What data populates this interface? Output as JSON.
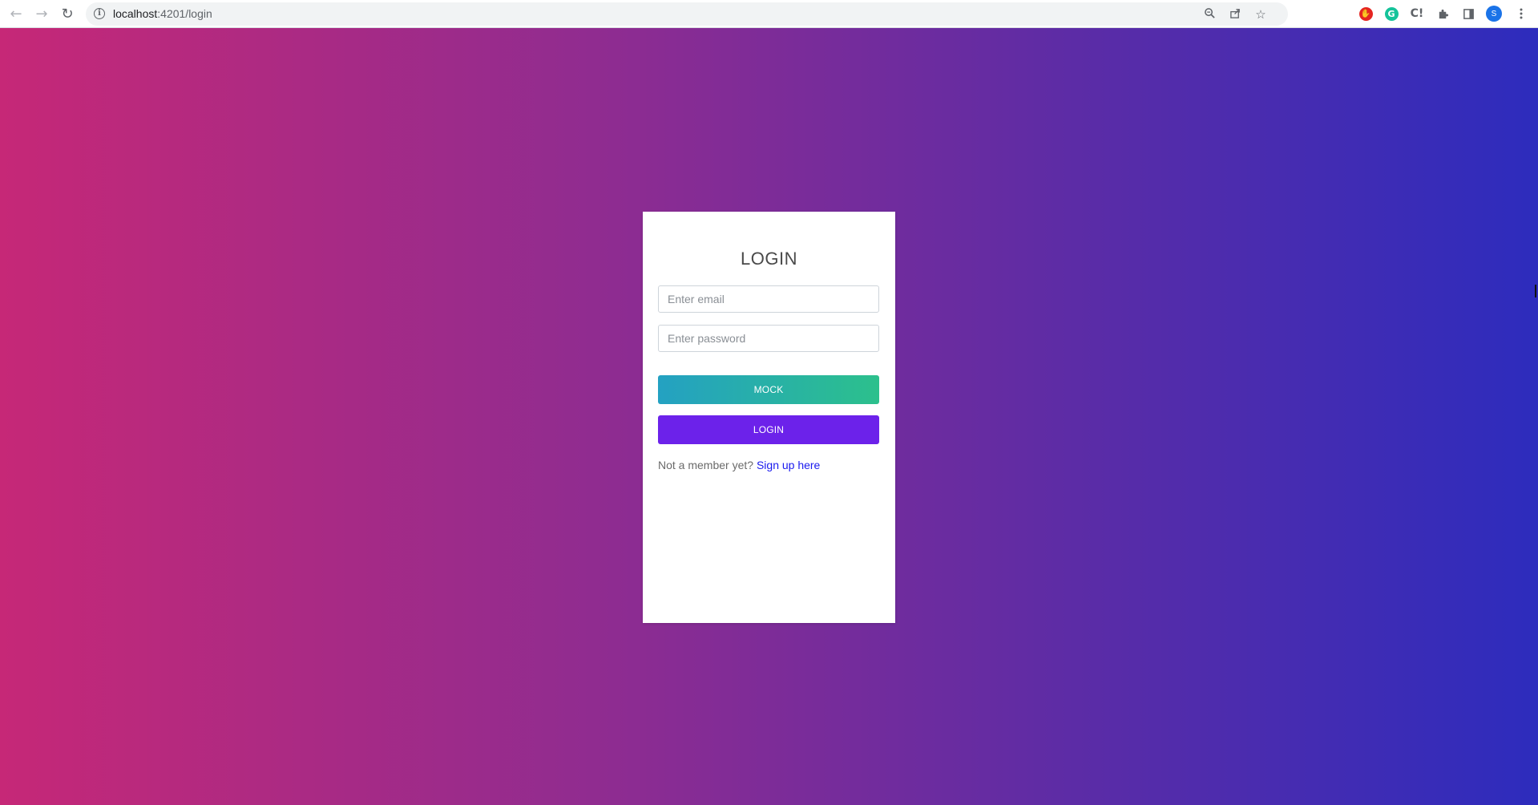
{
  "browser": {
    "url_host": "localhost",
    "url_path": ":4201/login",
    "back_icon": "arrow-left-icon",
    "forward_icon": "arrow-right-icon",
    "reload_icon": "reload-icon",
    "info_icon": "i",
    "zoom_icon": "zoom-icon",
    "share_icon": "share-icon",
    "star_icon": "star-icon",
    "extensions": [
      {
        "name": "adblock-icon"
      },
      {
        "name": "grammarly-icon",
        "letter": "G"
      },
      {
        "name": "extension-c-icon",
        "letter": "C!"
      },
      {
        "name": "puzzle-icon"
      },
      {
        "name": "side-panel-icon"
      }
    ],
    "avatar_letter": "S",
    "menu_icon": "kebab-menu-icon"
  },
  "login": {
    "title": "LOGIN",
    "email_placeholder": "Enter email",
    "email_value": "",
    "password_placeholder": "Enter password",
    "password_value": "",
    "mock_button": "MOCK",
    "login_button": "LOGIN",
    "signup_prompt": "Not a member yet?",
    "signup_link": "Sign up here"
  },
  "colors": {
    "background_gradient": [
      "#c62877",
      "#8e2c91",
      "#5c2ca6",
      "#2d2cbd"
    ],
    "mock_button_gradient": [
      "#24a1c2",
      "#2cc08c"
    ],
    "login_button": "#6c22ea",
    "link": "#1a1aee"
  }
}
